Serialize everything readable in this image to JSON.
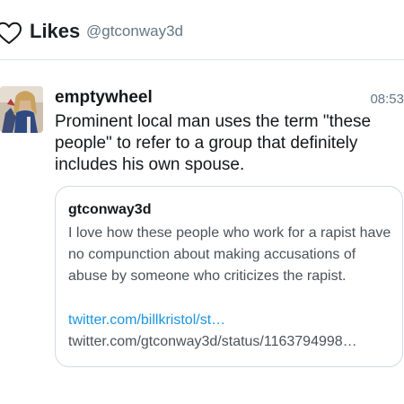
{
  "header": {
    "icon": "heart-outline-icon",
    "title": "Likes",
    "handle": "@gtconway3d"
  },
  "tweet": {
    "author": "emptywheel",
    "time": "08:53",
    "text": "Prominent local man uses the term \"these people\" to refer to a group that definitely includes his own spouse.",
    "quote": {
      "author": "gtconway3d",
      "text": "I love how these people who work for a rapist have no compunction about making accusations of abuse by someone who criticizes the rapist.",
      "link": "twitter.com/billkristol/st…",
      "url": "twitter.com/gtconway3d/status/1163794998…"
    }
  },
  "colors": {
    "link": "#1b95e0",
    "secondary_text": "#657786",
    "border": "#d4dbe1"
  }
}
